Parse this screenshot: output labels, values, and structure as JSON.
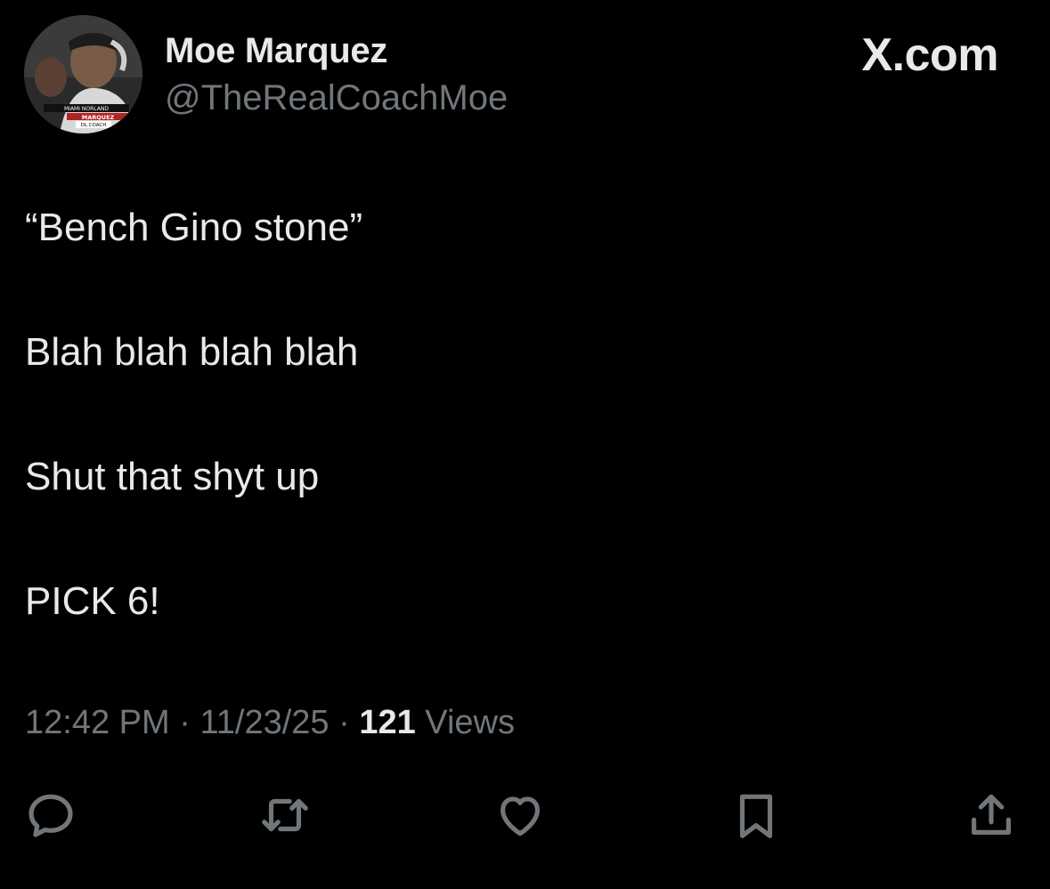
{
  "author": {
    "display_name": "Moe Marquez",
    "handle": "@TheRealCoachMoe",
    "avatar_text": [
      "MIAMI NORLAND",
      "MARQUEZ",
      "DL COACH"
    ]
  },
  "brand": "X.com",
  "tweet": {
    "lines": [
      "“Bench Gino stone”",
      "Blah blah blah blah",
      "Shut that shyt up",
      "PICK 6!"
    ]
  },
  "meta": {
    "time": "12:42 PM",
    "separator1": " · ",
    "date": "11/23/25",
    "separator2": " · ",
    "views_count": "121",
    "views_label": " Views"
  },
  "actions": [
    {
      "name": "reply",
      "icon": "reply-icon"
    },
    {
      "name": "repost",
      "icon": "repost-icon"
    },
    {
      "name": "like",
      "icon": "like-icon"
    },
    {
      "name": "bookmark",
      "icon": "bookmark-icon"
    },
    {
      "name": "share",
      "icon": "share-icon"
    }
  ],
  "colors": {
    "background": "#000000",
    "primary_text": "#e7e9ea",
    "secondary_text": "#71767b"
  }
}
